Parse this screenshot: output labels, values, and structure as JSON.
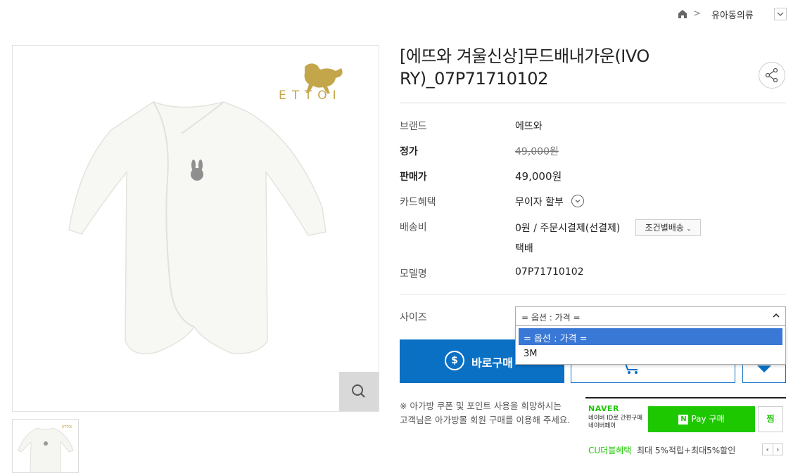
{
  "breadcrumb": {
    "category": "유아동의류"
  },
  "brand_logo": "ETTOI",
  "product": {
    "title": "[에뜨와 겨울신상]무드배내가운(IVORY)_07P71710102",
    "title_line1": "[에뜨와 겨울신상]무드배내가운(IVO",
    "title_line2": "RY)_07P71710102"
  },
  "info": {
    "brand_label": "브랜드",
    "brand_value": "에뜨와",
    "list_price_label": "정가",
    "list_price_value": "49,000원",
    "sale_price_label": "판매가",
    "sale_price_value": "49,000원",
    "card_label": "카드혜택",
    "card_value": "무이자 할부",
    "shipping_label": "배송비",
    "shipping_value": "0원  / 주문시결제(선결제)",
    "shipping_button": "조건별배송",
    "shipping_method": "택배",
    "model_label": "모델명",
    "model_value": "07P71710102"
  },
  "size": {
    "label": "사이즈",
    "selected": "= 옵션 : 가격 =",
    "options": [
      "= 옵션 : 가격 =",
      "3M"
    ]
  },
  "actions": {
    "buy_label": "바로구매"
  },
  "notice": {
    "line1": "※ 아가방 쿠폰 및 포인트 사용을 희망하시는",
    "line2": "고객님은 아가방몰 회원 구매를 이용해 주세요."
  },
  "naver": {
    "logo": "NAVER",
    "sub_line1": "네이버 ID로 간편구매",
    "sub_line2": "네이버페이",
    "pay_label": "Pay 구매",
    "jjim_label": "찜",
    "cu_title": "CU더블혜택",
    "cu_desc": "최대 5%적립+최대5%할인"
  },
  "colors": {
    "primary_blue": "#0a70c4",
    "naver_green": "#1ec800",
    "select_highlight": "#3a78d6"
  }
}
